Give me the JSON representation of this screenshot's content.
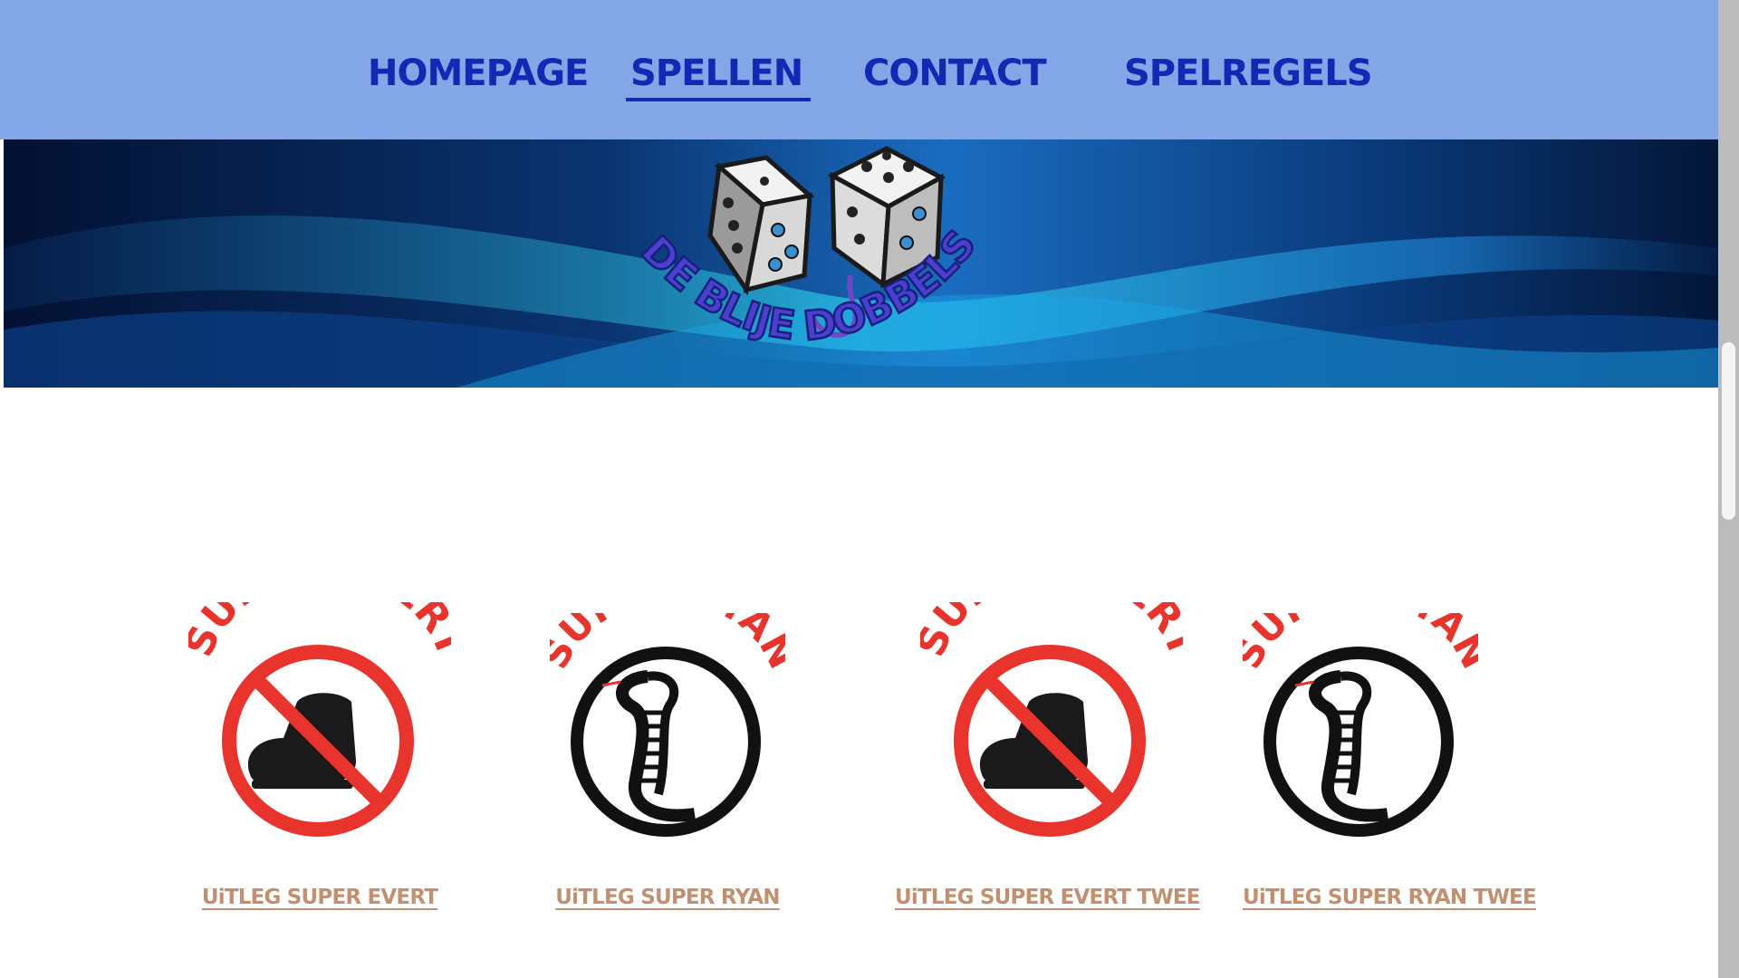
{
  "nav": {
    "items": [
      {
        "label": "HOMEPAGE",
        "active": false
      },
      {
        "label": "SPELLEN",
        "active": true
      },
      {
        "label": "CONTACT",
        "active": false
      },
      {
        "label": "SPELREGELS",
        "active": false
      }
    ]
  },
  "banner": {
    "logo_text": "DE BLIJE DOBBELSTEEN",
    "logo_icon": "dice-icon"
  },
  "games": [
    {
      "logo_title": "SUPER EVERT",
      "logo_icon": "no-boot-icon",
      "link": "UiTLEG SUPER EVERT"
    },
    {
      "logo_title": "SUPER RYAN",
      "logo_icon": "cobra-icon",
      "link": "UiTLEG SUPER RYAN"
    },
    {
      "logo_title": "SUPER EVERT",
      "logo_icon": "no-boot-icon",
      "link": "UiTLEG SUPER EVERT TWEE"
    },
    {
      "logo_title": "SUPER RYAN",
      "logo_icon": "cobra-icon",
      "link": "UiTLEG SUPER RYAN TWEE"
    }
  ],
  "colors": {
    "nav_background": "#82a6e6",
    "nav_text": "#1428b4",
    "logo_red": "#e8342c",
    "link_color": "#c29071",
    "banner_dark": "#04163a",
    "banner_light": "#2fd7f0"
  }
}
